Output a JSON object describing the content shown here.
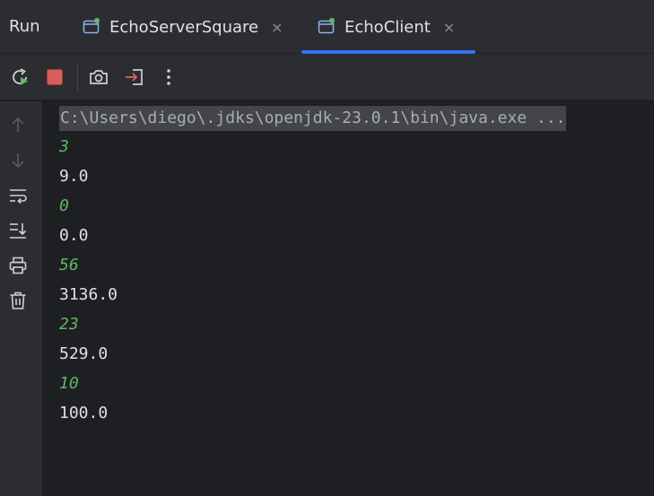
{
  "header": {
    "title": "Run",
    "tabs": [
      {
        "label": "EchoServerSquare",
        "close": "×"
      },
      {
        "label": "EchoClient",
        "close": "×",
        "active": true
      }
    ]
  },
  "toolbar": {
    "buttons": [
      "rerun-icon",
      "stop-icon",
      "screenshot-icon",
      "exit-icon",
      "more-icon"
    ]
  },
  "gutter": {
    "buttons": [
      "arrow-up-icon",
      "arrow-down-icon",
      "soft-wrap-icon",
      "scroll-to-end-icon",
      "print-icon",
      "trash-icon"
    ]
  },
  "console": {
    "command": "C:\\Users\\diego\\.jdks\\openjdk-23.0.1\\bin\\java.exe ...",
    "lines": [
      {
        "text": "3",
        "kind": "input"
      },
      {
        "text": "9.0",
        "kind": "output"
      },
      {
        "text": "0",
        "kind": "input"
      },
      {
        "text": "0.0",
        "kind": "output"
      },
      {
        "text": "56",
        "kind": "input"
      },
      {
        "text": "3136.0",
        "kind": "output"
      },
      {
        "text": "23",
        "kind": "input"
      },
      {
        "text": "529.0",
        "kind": "output"
      },
      {
        "text": "10",
        "kind": "input"
      },
      {
        "text": "100.0",
        "kind": "output"
      }
    ]
  },
  "colors": {
    "background": "#1e1f22",
    "panel": "#2b2d30",
    "accent": "#3574f0",
    "input_text": "#5fb865",
    "output_text": "#dfe1e5",
    "stop": "#db5c5c",
    "running_dot": "#5fb865"
  }
}
